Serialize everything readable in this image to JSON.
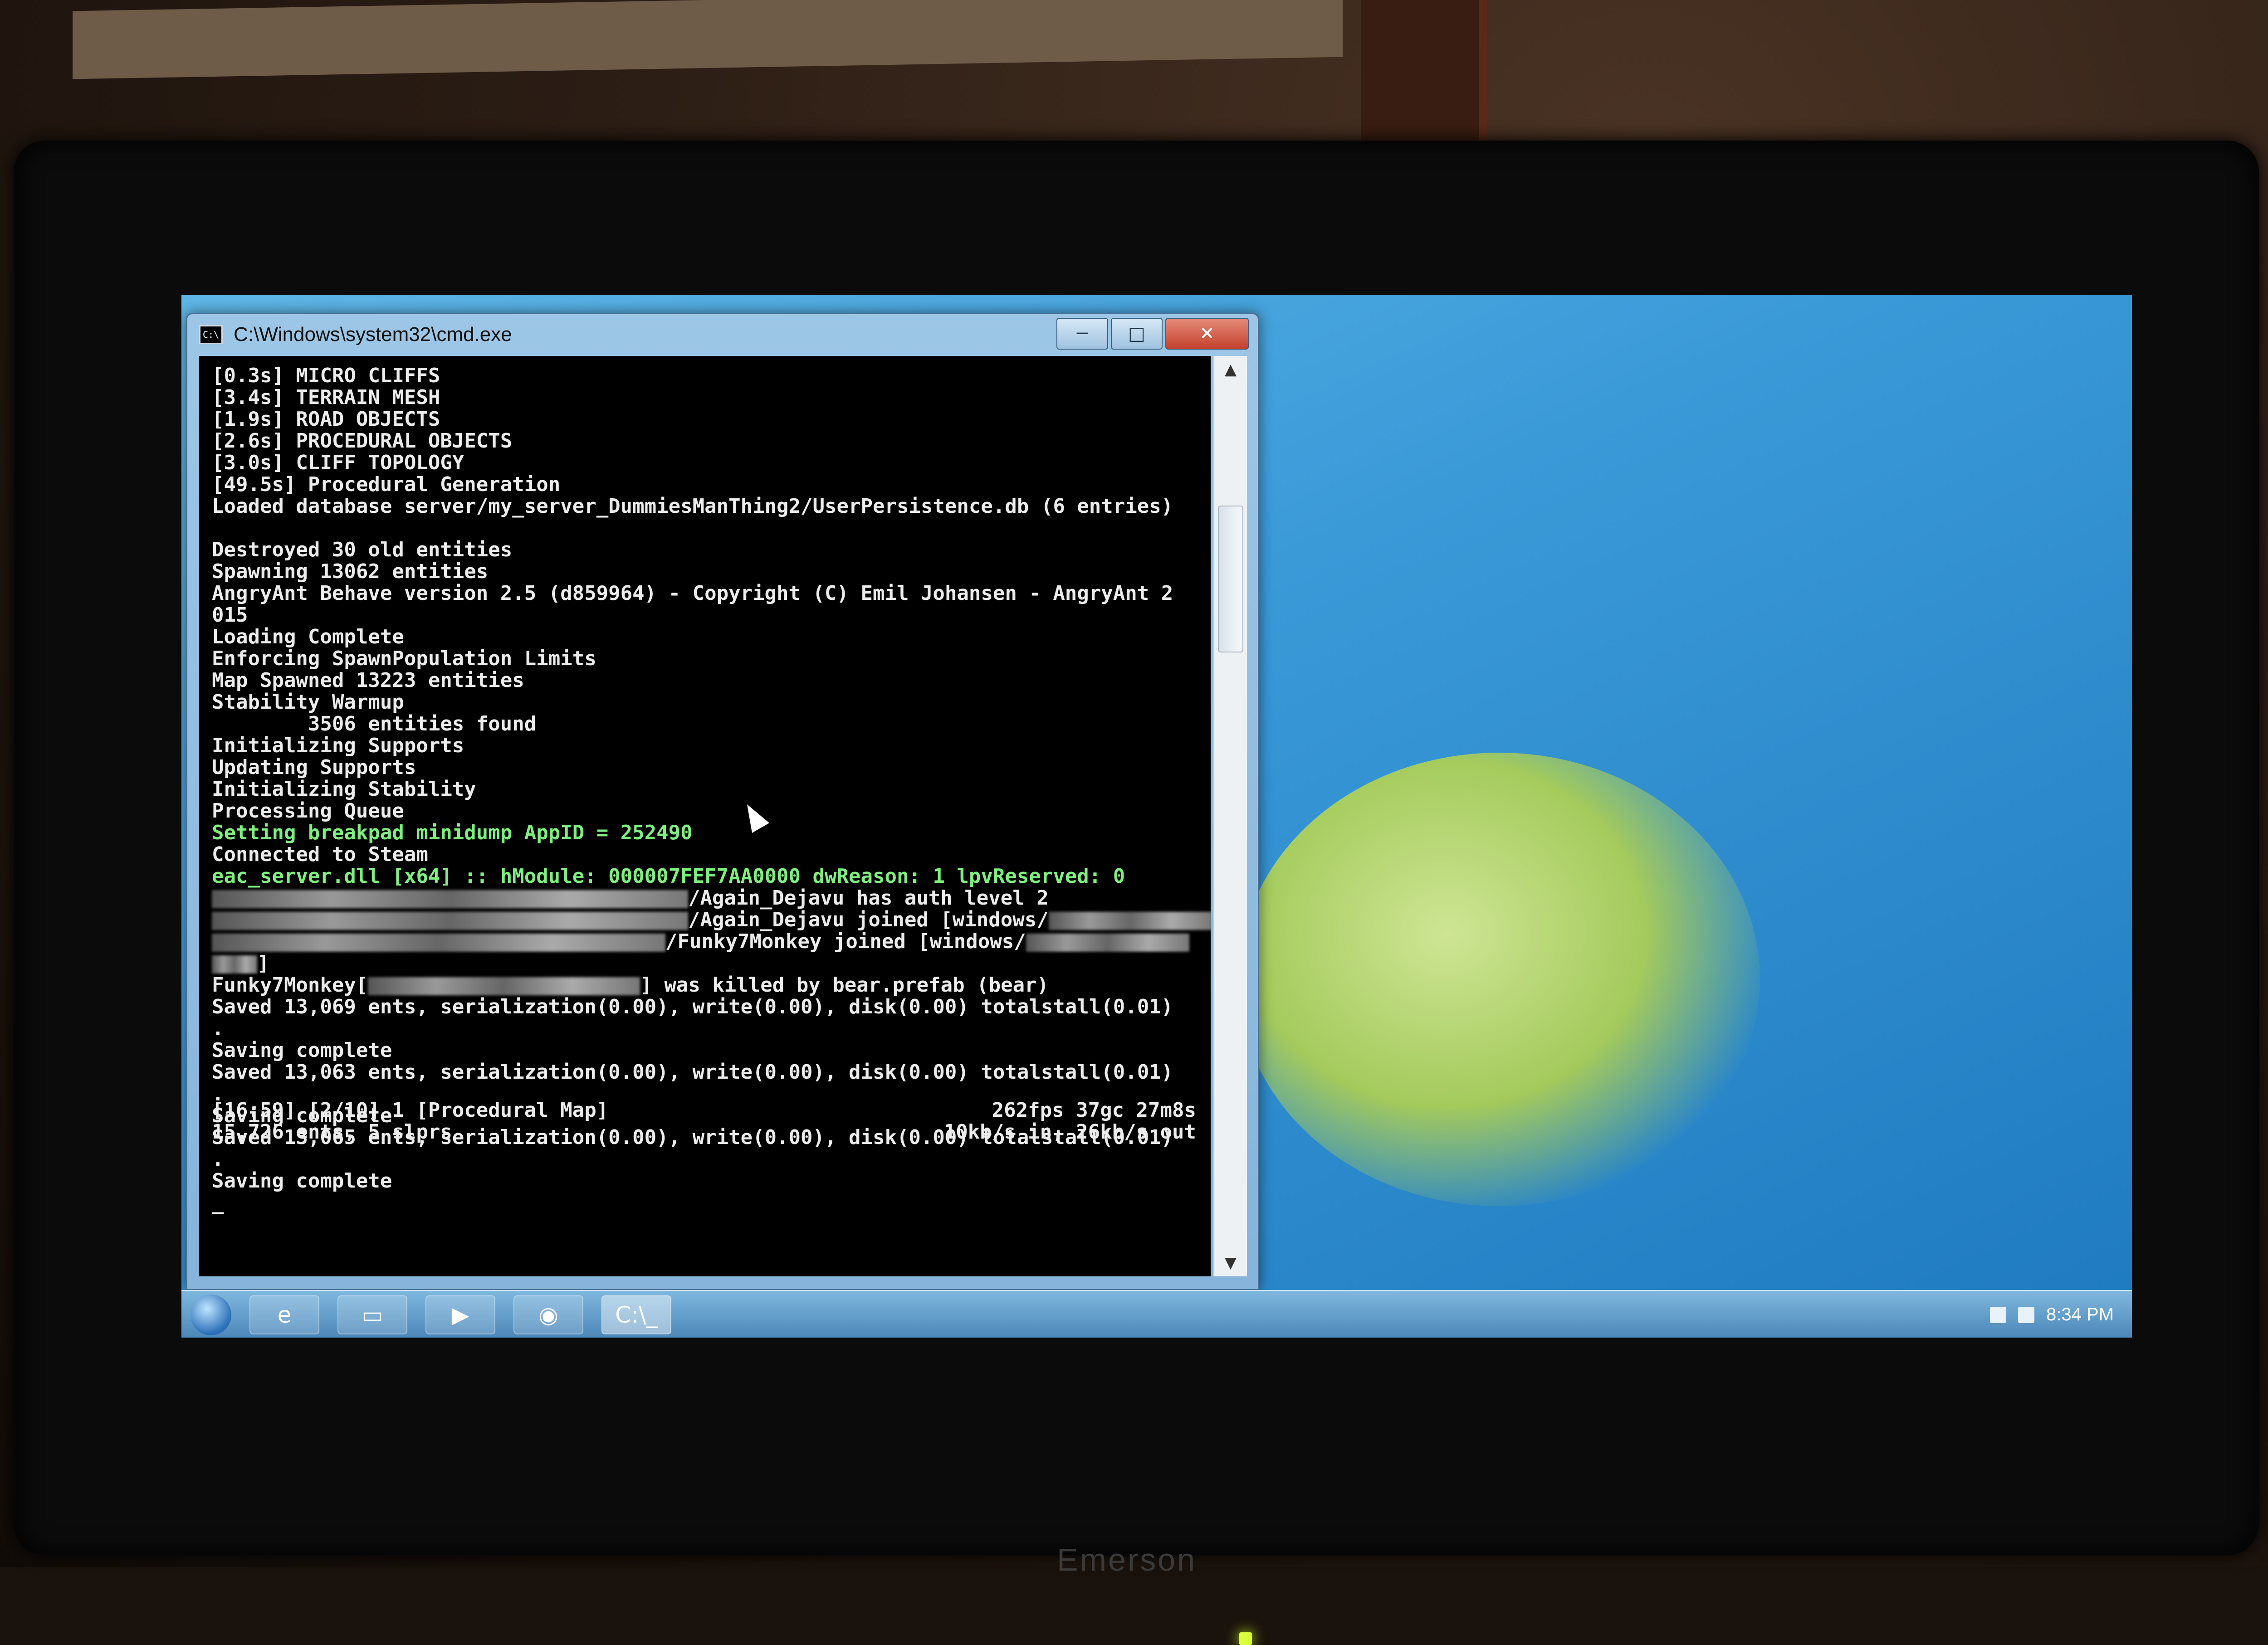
{
  "window": {
    "title": "C:\\Windows\\system32\\cmd.exe",
    "icon_label": "C:\\",
    "controls": {
      "minimize": "─",
      "maximize": "□",
      "close": "✕"
    }
  },
  "console": {
    "lines": [
      "[0.3s] MICRO CLIFFS",
      "[3.4s] TERRAIN MESH",
      "[1.9s] ROAD OBJECTS",
      "[2.6s] PROCEDURAL OBJECTS",
      "[3.0s] CLIFF TOPOLOGY",
      "[49.5s] Procedural Generation",
      "Loaded database server/my_server_DummiesManThing2/UserPersistence.db (6 entries)",
      "",
      "Destroyed 30 old entities",
      "Spawning 13062 entities",
      "AngryAnt Behave version 2.5 (d859964) - Copyright (C) Emil Johansen - AngryAnt 2",
      "015",
      "Loading Complete",
      "Enforcing SpawnPopulation Limits",
      "Map Spawned 13223 entities",
      "Stability Warmup",
      "        3506 entities found",
      "Initializing Supports",
      "Updating Supports",
      "Initializing Stability",
      "Processing Queue"
    ],
    "green_lines": [
      "Setting breakpad minidump AppID = 252490"
    ],
    "connected": "Connected to Steam",
    "eac_line": "eac_server.dll [x64] :: hModule: 000007FEF7AA0000 dwReason: 1 lpvReserved: 0",
    "redacted_lines": [
      "/Again_Dejavu has auth level 2",
      "/Again_Dejavu joined [windows/",
      "]",
      "/Funky7Monkey joined [windows/",
      "]"
    ],
    "kill_prefix": "Funky7Monkey[",
    "kill_suffix": "] was killed by bear.prefab (bear)",
    "saves": [
      "Saved 13,069 ents, serialization(0.00), write(0.00), disk(0.00) totalstall(0.01)",
      ".",
      "Saving complete",
      "Saved 13,063 ents, serialization(0.00), write(0.00), disk(0.00) totalstall(0.01)",
      ".",
      "Saving complete",
      "Saved 13,065 ents, serialization(0.00), write(0.00), disk(0.00) totalstall(0.01)",
      ".",
      "Saving complete",
      "_"
    ],
    "status": {
      "left_1": "[16:59] [2/10] 1 [Procedural Map]",
      "left_2": "15,726 ents, 5 slprs",
      "right_1": "262fps 37gc 27m8s",
      "right_2": "10kb/s in, 26kb/s out"
    }
  },
  "taskbar": {
    "cmd_button_label": "C:\\_",
    "clock": "8:34 PM"
  },
  "monitor": {
    "brand": "Emerson"
  },
  "colors": {
    "console_bg": "#000000",
    "console_text": "#ececec",
    "console_green": "#7ff07f",
    "desktop": "#3a9ad8"
  }
}
